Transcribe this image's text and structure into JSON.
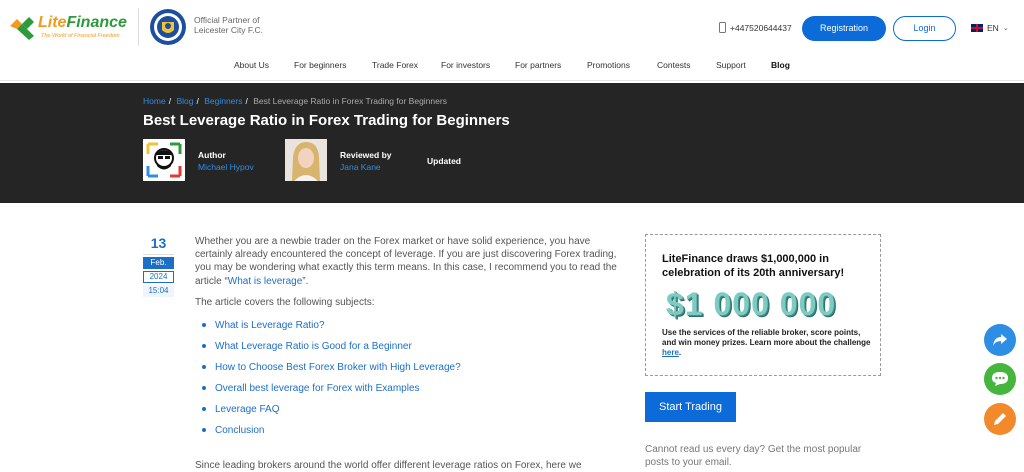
{
  "header": {
    "logo": {
      "brand_lite": "Lite",
      "brand_finance": "Finance",
      "tagline": "The World of Financial Freedom"
    },
    "partner_text": "Official Partner of Leicester City F.C.",
    "phone": "+447520644437",
    "registration_label": "Registration",
    "login_label": "Login",
    "language": "EN"
  },
  "nav": {
    "items": [
      "About Us",
      "For beginners",
      "Trade Forex",
      "For investors",
      "For partners",
      "Promotions",
      "Contests",
      "Support",
      "Blog"
    ],
    "active": "Blog"
  },
  "hero": {
    "breadcrumbs": [
      "Home",
      "Blog",
      "Beginners",
      "Best Leverage Ratio in Forex Trading for Beginners"
    ],
    "title": "Best Leverage Ratio in Forex Trading for Beginners",
    "author_label": "Author",
    "author_name": "Michael Hypov",
    "reviewer_label": "Reviewed by",
    "reviewer_name": "Jana Kane",
    "updated_label": "Updated"
  },
  "date": {
    "day": "13",
    "month": "Feb.",
    "year": "2024",
    "time": "15:04"
  },
  "article": {
    "intro_before_link": "Whether you are a newbie trader on the Forex market or have solid experience, you have certainly already encountered the concept of leverage. If you are just discovering Forex trading, you may be wondering what exactly this term means. In this case, I recommend you to read the article “",
    "intro_link": "What is leverage",
    "intro_after_link": "”.",
    "subjects_intro": "The article covers the following subjects:",
    "toc": [
      "What is Leverage Ratio?",
      "What Leverage Ratio is Good for a Beginner",
      "How to Choose Best Forex Broker with High Leverage?",
      "Overall best leverage for Forex with Examples",
      "Leverage FAQ",
      "Conclusion"
    ],
    "next_paragraph": "Since leading brokers around the world offer different leverage ratios on Forex, here we"
  },
  "sidebar": {
    "promo_title": "LiteFinance draws $1,000,000 in celebration of its 20th anniversary!",
    "promo_amount": "$1 000 000",
    "promo_text_before_link": "Use the services of the reliable broker, score points, and win money prizes. Learn more about the challenge ",
    "promo_link": "here",
    "promo_text_after_link": ".",
    "start_trading_label": "Start Trading",
    "subscribe_text": "Cannot read us every day? Get the most popular posts to your email."
  },
  "fabs": {
    "share_icon": "share-arrow-icon",
    "chat_icon": "chat-bubble-icon",
    "edit_icon": "pencil-icon"
  }
}
